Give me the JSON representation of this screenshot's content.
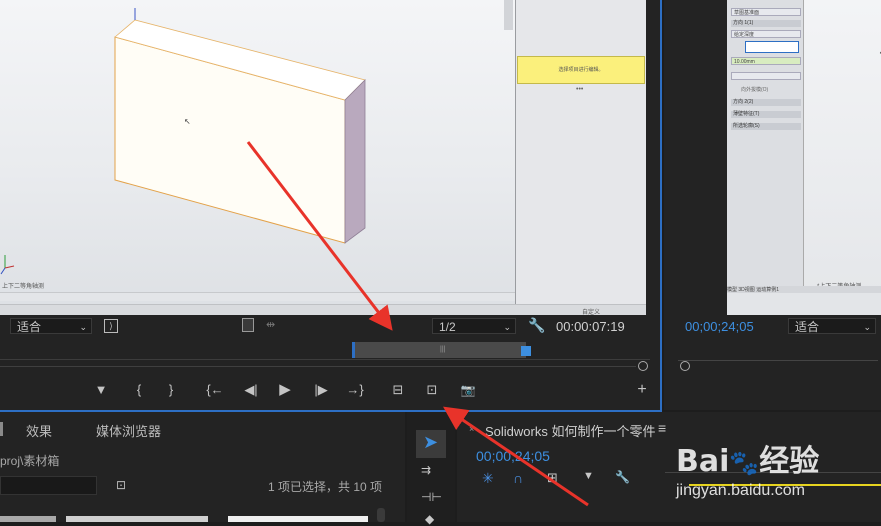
{
  "source_monitor": {
    "fit_label": "适合",
    "resolution_label": "1/2",
    "timecode": "00:00:07:19",
    "embedded_app": {
      "message_text": "选择项目进行编辑。",
      "view_label": "上下二等角轴测",
      "status_text": "自定义"
    },
    "transport": {
      "marker": "▼",
      "in": "{",
      "out": "}",
      "go_in": "{←",
      "step_back": "◀|",
      "play": "▶",
      "step_fwd": "|▶",
      "go_out": "→}",
      "insert": "⊟",
      "overwrite": "⊡",
      "export_frame": "📷",
      "add": "+"
    }
  },
  "program_monitor": {
    "timecode": "00;00;24;05",
    "fit_label": "适合",
    "embedded_app": {
      "field_1": "草图基准面",
      "section_1": "方向 1(1)",
      "field_2": "给定深度",
      "depth_value": "10.00mm",
      "option": "向外拔模(O)",
      "section_2": "方向 2(2)",
      "section_3": "薄壁特征(T)",
      "section_4": "所选轮廓(S)",
      "view_label": "*上下二等角轴测",
      "tab_1": "模型",
      "tab_2": "3D视图",
      "tab_3": "运动算例1"
    }
  },
  "bottom_left": {
    "tabs": [
      "效果",
      "媒体浏览器"
    ],
    "path": "proj\\素材箱",
    "status": "1 项已选择，共 10 项"
  },
  "timeline": {
    "sequence_title": "Solidworks 如何制作一个零件",
    "menu_icon": "≡",
    "timecode": "00;00;24;05"
  },
  "watermark": {
    "brand": "Bai",
    "brand2": "经验",
    "url": "jingyan.baidu.com"
  },
  "colors": {
    "accent_blue": "#2d6fc4",
    "arrow_red": "#e8332a",
    "message_yellow": "#fbf07c"
  }
}
